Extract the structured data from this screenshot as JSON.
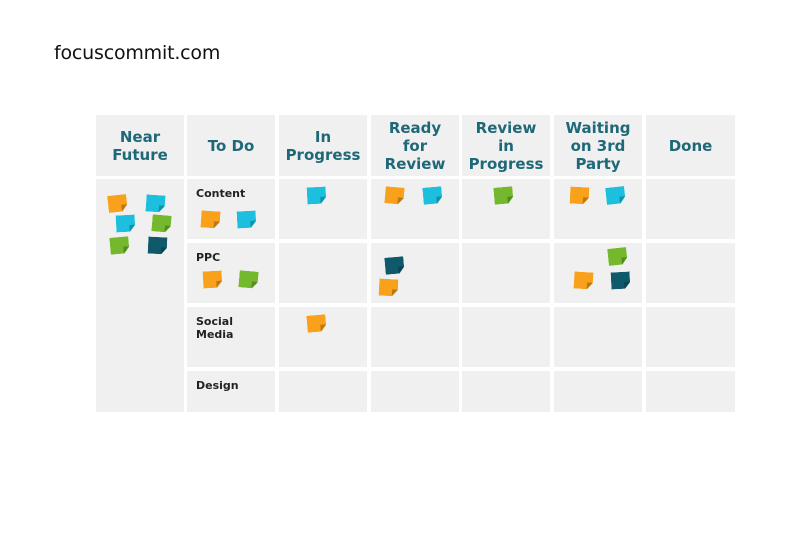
{
  "site": {
    "title": "focuscommit.com"
  },
  "colors": {
    "orange": "#f9a11b",
    "cyan": "#1cc0de",
    "green": "#74b92d",
    "teal": "#0f5a6a",
    "header_text": "#1e6878",
    "cell_bg": "#f0f0f0"
  },
  "board": {
    "columns": [
      {
        "label": "Near\nFuture"
      },
      {
        "label": "To Do"
      },
      {
        "label": "In\nProgress"
      },
      {
        "label": "Ready\nfor\nReview"
      },
      {
        "label": "Review\nin\nProgress"
      },
      {
        "label": "Waiting\non 3rd\nParty"
      },
      {
        "label": "Done"
      }
    ],
    "swimlanes": [
      {
        "label": "Content"
      },
      {
        "label": "PPC"
      },
      {
        "label": "Social\nMedia"
      },
      {
        "label": "Design"
      }
    ],
    "near_future_notes": [
      "orange",
      "cyan",
      "cyan",
      "green",
      "green",
      "teal"
    ],
    "lane_notes": {
      "Content": {
        "To Do": [
          "orange",
          "cyan"
        ],
        "In Progress": [
          "cyan"
        ],
        "Ready for Review": [
          "orange",
          "cyan"
        ],
        "Review in Progress": [
          "green"
        ],
        "Waiting on 3rd Party": [
          "orange",
          "cyan"
        ],
        "Done": []
      },
      "PPC": {
        "To Do": [
          "orange",
          "green"
        ],
        "In Progress": [],
        "Ready for Review": [
          "teal",
          "orange"
        ],
        "Review in Progress": [],
        "Waiting on 3rd Party": [
          "green",
          "orange",
          "teal"
        ],
        "Done": []
      },
      "Social Media": {
        "To Do": [],
        "In Progress": [
          "orange"
        ],
        "Ready for Review": [],
        "Review in Progress": [],
        "Waiting on 3rd Party": [],
        "Done": []
      },
      "Design": {
        "To Do": [],
        "In Progress": [],
        "Ready for Review": [],
        "Review in Progress": [],
        "Waiting on 3rd Party": [],
        "Done": []
      }
    }
  }
}
